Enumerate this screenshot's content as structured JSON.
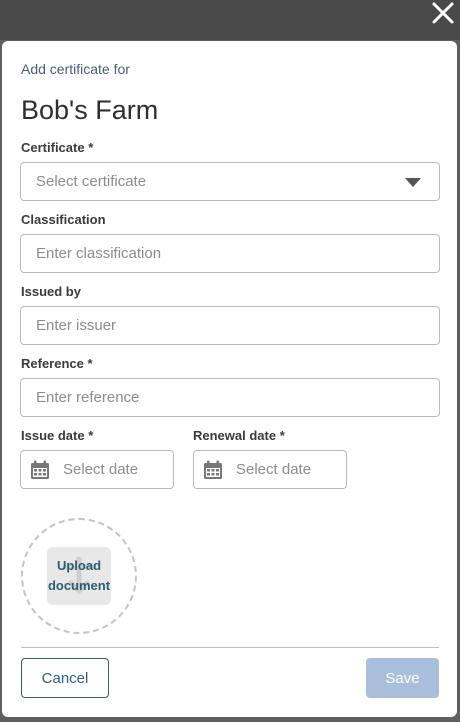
{
  "dialog": {
    "subtitle": "Add certificate for",
    "title": "Bob's Farm"
  },
  "form": {
    "certificate": {
      "label": "Certificate *",
      "placeholder": "Select certificate"
    },
    "classification": {
      "label": "Classification",
      "placeholder": "Enter classification"
    },
    "issued_by": {
      "label": "Issued by",
      "placeholder": "Enter issuer"
    },
    "reference": {
      "label": "Reference *",
      "placeholder": "Enter reference"
    },
    "issue_date": {
      "label": "Issue date *",
      "placeholder": "Select date"
    },
    "renewal_date": {
      "label": "Renewal date *",
      "placeholder": "Select date"
    }
  },
  "upload": {
    "label_line1": "Upload",
    "label_line2": "document"
  },
  "actions": {
    "cancel": "Cancel",
    "save": "Save"
  },
  "colors": {
    "overlay": "#5f5f5f",
    "accent": "#2f5f7c",
    "save_disabled": "#a9bfdc"
  },
  "icons": {
    "close": "close-icon",
    "dropdown": "chevron-down-icon",
    "calendar": "calendar-icon",
    "upload": "upload-icon"
  }
}
